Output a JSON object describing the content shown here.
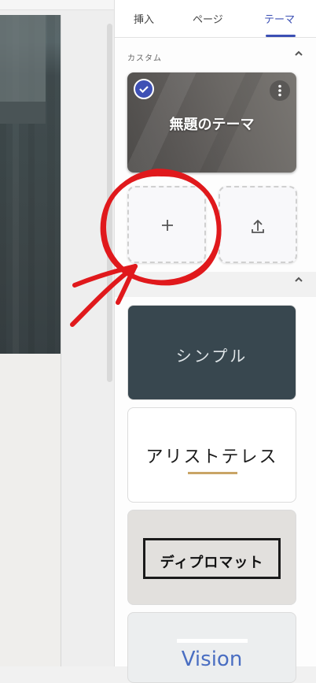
{
  "tabs": [
    {
      "label": "挿入"
    },
    {
      "label": "ページ"
    },
    {
      "label": "テーマ"
    }
  ],
  "active_tab": "テーマ",
  "custom_section": {
    "label": "カスタム",
    "theme_title": "無題のテーマ"
  },
  "themes": [
    {
      "name": "シンプル"
    },
    {
      "name": "アリストテレス"
    },
    {
      "name": "ディプロマット"
    },
    {
      "name": "Vision"
    }
  ],
  "icons": {
    "add": "plus-icon",
    "upload": "upload-icon",
    "check": "check-icon",
    "more": "more-vert-icon",
    "collapse": "chevron-up-icon"
  },
  "colors": {
    "accent": "#3c50b4",
    "annotation": "#e0191c"
  }
}
